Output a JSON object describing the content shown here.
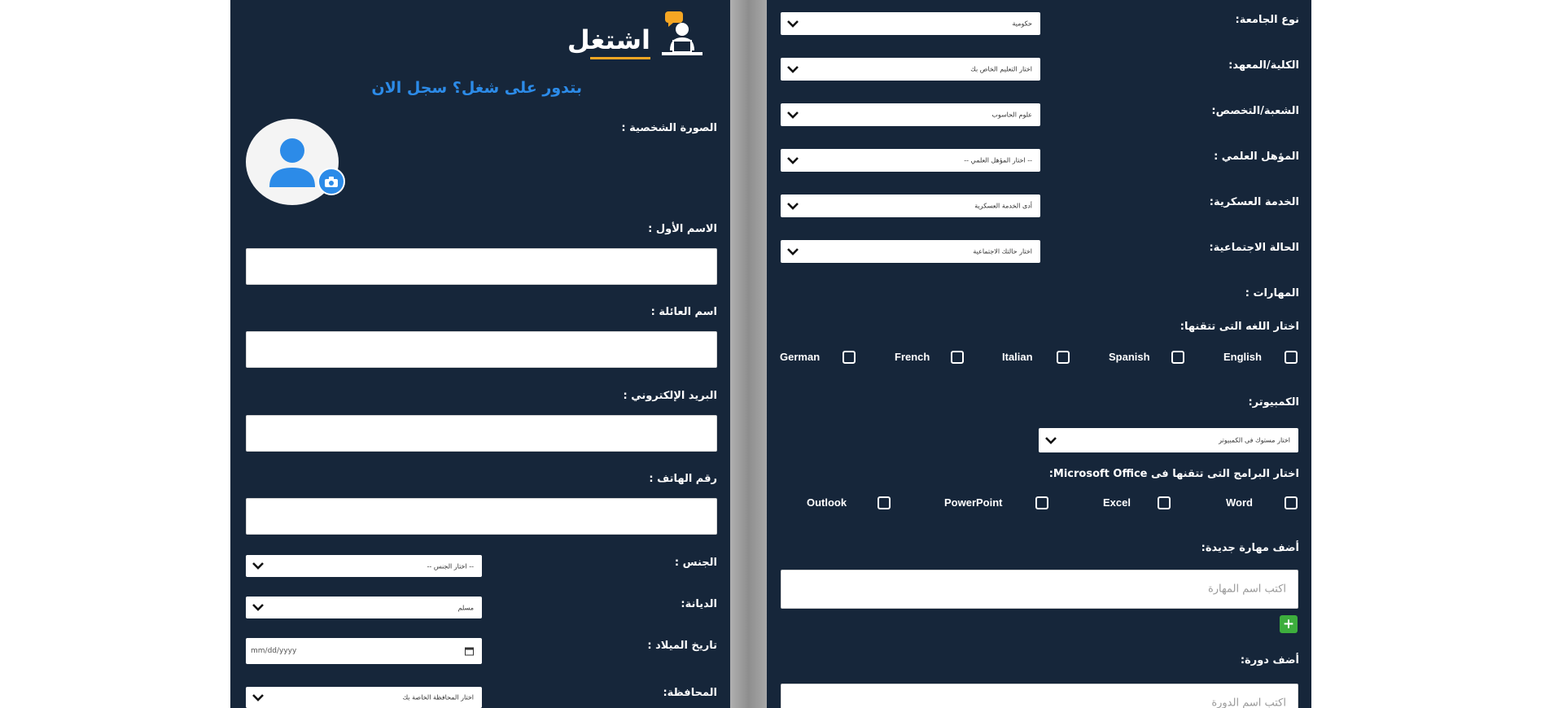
{
  "brand": {
    "logo_text": "اشتغل"
  },
  "left": {
    "tagline": "بتدور على شغل؟ سجل الان",
    "photo_label": "الصورة الشخصية :",
    "first_name_label": "الاسم الأول :",
    "last_name_label": "اسم العائلة :",
    "email_label": "البريد الإلكتروني :",
    "phone_label": "رقم الهاتف :",
    "gender": {
      "label": "الجنس :",
      "value": "-- اختار الجنس --"
    },
    "religion": {
      "label": "الديانة:",
      "value": "مسلم"
    },
    "birthdate": {
      "label": "تاريخ الميلاد :",
      "value": "mm/dd/yyyy"
    },
    "governorate": {
      "label": "المحافظة:",
      "value": "اختار المحافظة الخاصة بك"
    }
  },
  "right": {
    "university_type": {
      "label": "نوع الجامعة:",
      "value": "حكومية"
    },
    "faculty": {
      "label": "الكلية/المعهد:",
      "value": "اختار التعليم الخاص بك"
    },
    "major": {
      "label": "الشعبة/التخصص:",
      "value": "علوم الحاسوب"
    },
    "qualification": {
      "label": "المؤهل العلمي :",
      "value": "-- اختار المؤهل العلمي --"
    },
    "military": {
      "label": "الخدمة العسكرية:",
      "value": "أدى الخدمة العسكرية"
    },
    "marital": {
      "label": "الحالة الاجتماعية:",
      "value": "اختار حالتك الاجتماعية"
    },
    "skills_label": "المهارات :",
    "languages_label": "اختار اللغه التى تتقنها:",
    "languages": [
      "English",
      "Spanish",
      "Italian",
      "French",
      "German"
    ],
    "computer_label": "الكمبيوتر:",
    "computer_select": "اختار مستوك فى الكمبيوتر",
    "office_label": "اختار البرامج التى تتقنها فى Microsoft Office:",
    "office_apps": [
      "Word",
      "Excel",
      "PowerPoint",
      "Outlook"
    ],
    "new_skill_label": "أضف مهارة جديدة:",
    "new_skill_placeholder": "اكتب اسم المهارة",
    "add_icon_text": "+",
    "course_label": "أضف دورة:",
    "course_placeholder": "اكتب اسم الدورة"
  },
  "colors": {
    "panel_bg": "#16263a",
    "accent_blue": "#2c8be8",
    "logo_orange": "#f5a623",
    "add_green": "#3dae3d"
  }
}
